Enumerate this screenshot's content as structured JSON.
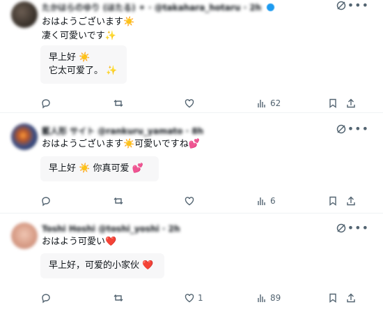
{
  "tweets": [
    {
      "header_blurred": "たかはらのゆり (ほたる) ✦ · @takahara_hotaru · 2h",
      "text_lines": [
        "おはようございます☀️",
        "凄く可愛いです✨"
      ],
      "translation_lines": [
        "早上好 ☀️",
        "它太可爱了。 ✨"
      ],
      "stats": {
        "reply": "",
        "retweet": "",
        "like": "",
        "views": "62"
      }
    },
    {
      "header_blurred": "藍人形 サイト @rankuru_yamato · 8h",
      "text_lines": [
        "おはようございます☀️可愛いですね💕"
      ],
      "translation_lines": [
        "早上好 ☀️ 你真可爱 💕"
      ],
      "stats": {
        "reply": "",
        "retweet": "",
        "like": "",
        "views": "6"
      }
    },
    {
      "header_blurred": "Toshi Hoshi @toshi_yoshi · 2h",
      "text_lines": [
        "おはよう可愛い❤️"
      ],
      "translation_lines": [
        "早上好，可爱的小家伙 ❤️"
      ],
      "stats": {
        "reply": "",
        "retweet": "",
        "like": "1",
        "views": "89"
      }
    }
  ],
  "icons": [
    "grok-icon",
    "more-icon",
    "reply-icon",
    "retweet-icon",
    "like-icon",
    "views-icon",
    "bookmark-icon",
    "share-icon"
  ],
  "colors": {
    "muted": "#536471",
    "translation_bg": "#f7f7f8",
    "verified": "#1d9bf0"
  }
}
